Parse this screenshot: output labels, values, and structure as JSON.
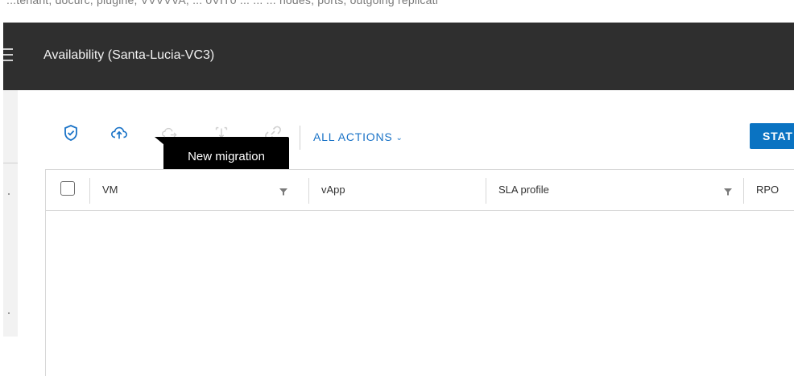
{
  "top_strip_text": "...tenant, docurc, plugine, VVVVVA, ... 0VIT0 ... ... ... nodes, ports, outgoing replicati",
  "header": {
    "title": "Availability (Santa-Lucia-VC3)"
  },
  "toolbar": {
    "tooltip": "New migration",
    "all_actions_label": "ALL ACTIONS",
    "start_button_label": "STAT"
  },
  "grid": {
    "columns": [
      "VM",
      "vApp",
      "SLA profile",
      "RPO"
    ]
  },
  "colors": {
    "header_bg": "#2f2f2f",
    "accent": "#1a73c7",
    "primary_button": "#0a73c2"
  },
  "icons": [
    "menu-icon",
    "shield-check-icon",
    "cloud-upload-icon",
    "cloud-move-icon",
    "sync-icon",
    "link-icon",
    "chevron-down-icon",
    "filter-icon"
  ]
}
